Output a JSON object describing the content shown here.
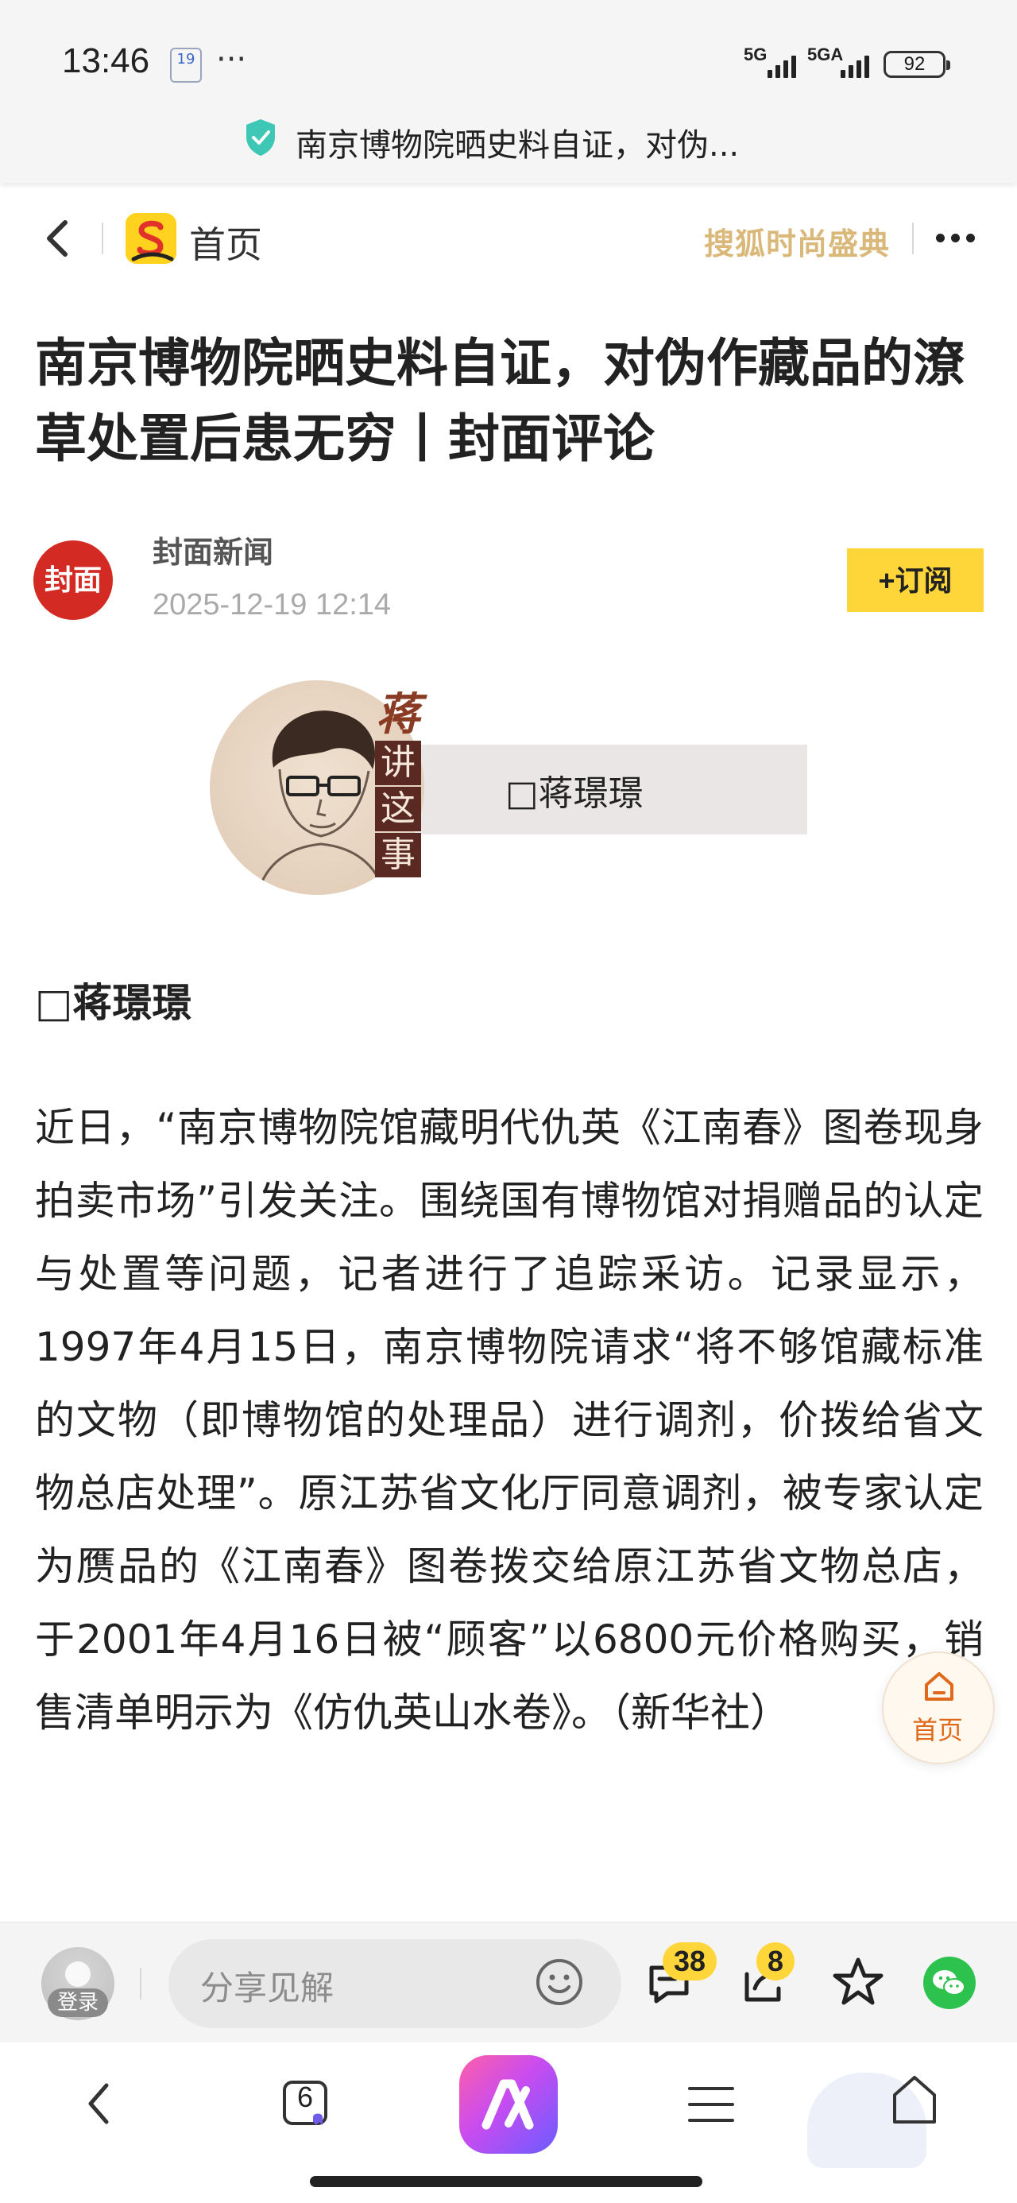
{
  "status_bar": {
    "time": "13:46",
    "calendar_day": "19",
    "more": "···",
    "network_1": "5G",
    "network_2": "5GA",
    "battery": "92"
  },
  "url_bar": {
    "title": "南京博物院晒史料自证，对伪...",
    "icon": "shield-check-icon",
    "icon_color": "#3ec7b5"
  },
  "nav": {
    "home_label": "首页",
    "brand_text": "搜狐时尚盛典",
    "logo": "sohu-logo"
  },
  "article": {
    "headline": "南京博物院晒史料自证，对伪作藏品的潦草处置后患无穷丨封面评论",
    "author": "封面新闻",
    "author_avatar_text": "封面",
    "date": "2025-12-19 12:14",
    "subscribe_label": "+订阅",
    "banner": {
      "byline": "□蒋璟璟",
      "column_chars": [
        "蒋",
        "讲",
        "这",
        "事"
      ]
    },
    "byline": "□蒋璟璟",
    "body": "近日，“南京博物院馆藏明代仇英《江南春》图卷现身拍卖市场”引发关注。围绕国有博物馆对捐赠品的认定与处置等问题，记者进行了追踪采访。记录显示，1997年4月15日，南京博物院请求“将不够馆藏标准的文物（即博物馆的处理品）进行调剂，价拨给省文物总店处理”。原江苏省文化厅同意调剂，被专家认定为赝品的《江南春》图卷拨交给原江苏省文物总店，于2001年4月16日被“顾客”以6800元价格购买，销售清单明示为《仿仇英山水卷》。（新华社）"
  },
  "float_home": {
    "label": "首页"
  },
  "comment_bar": {
    "login_label": "登录",
    "placeholder": "分享见解",
    "comment_count": "38",
    "share_count": "8"
  },
  "browser_nav": {
    "tab_count": "6"
  },
  "colors": {
    "accent_yellow": "#ffd63a",
    "brand_red": "#d42a24",
    "home_orange": "#e06a1b"
  }
}
